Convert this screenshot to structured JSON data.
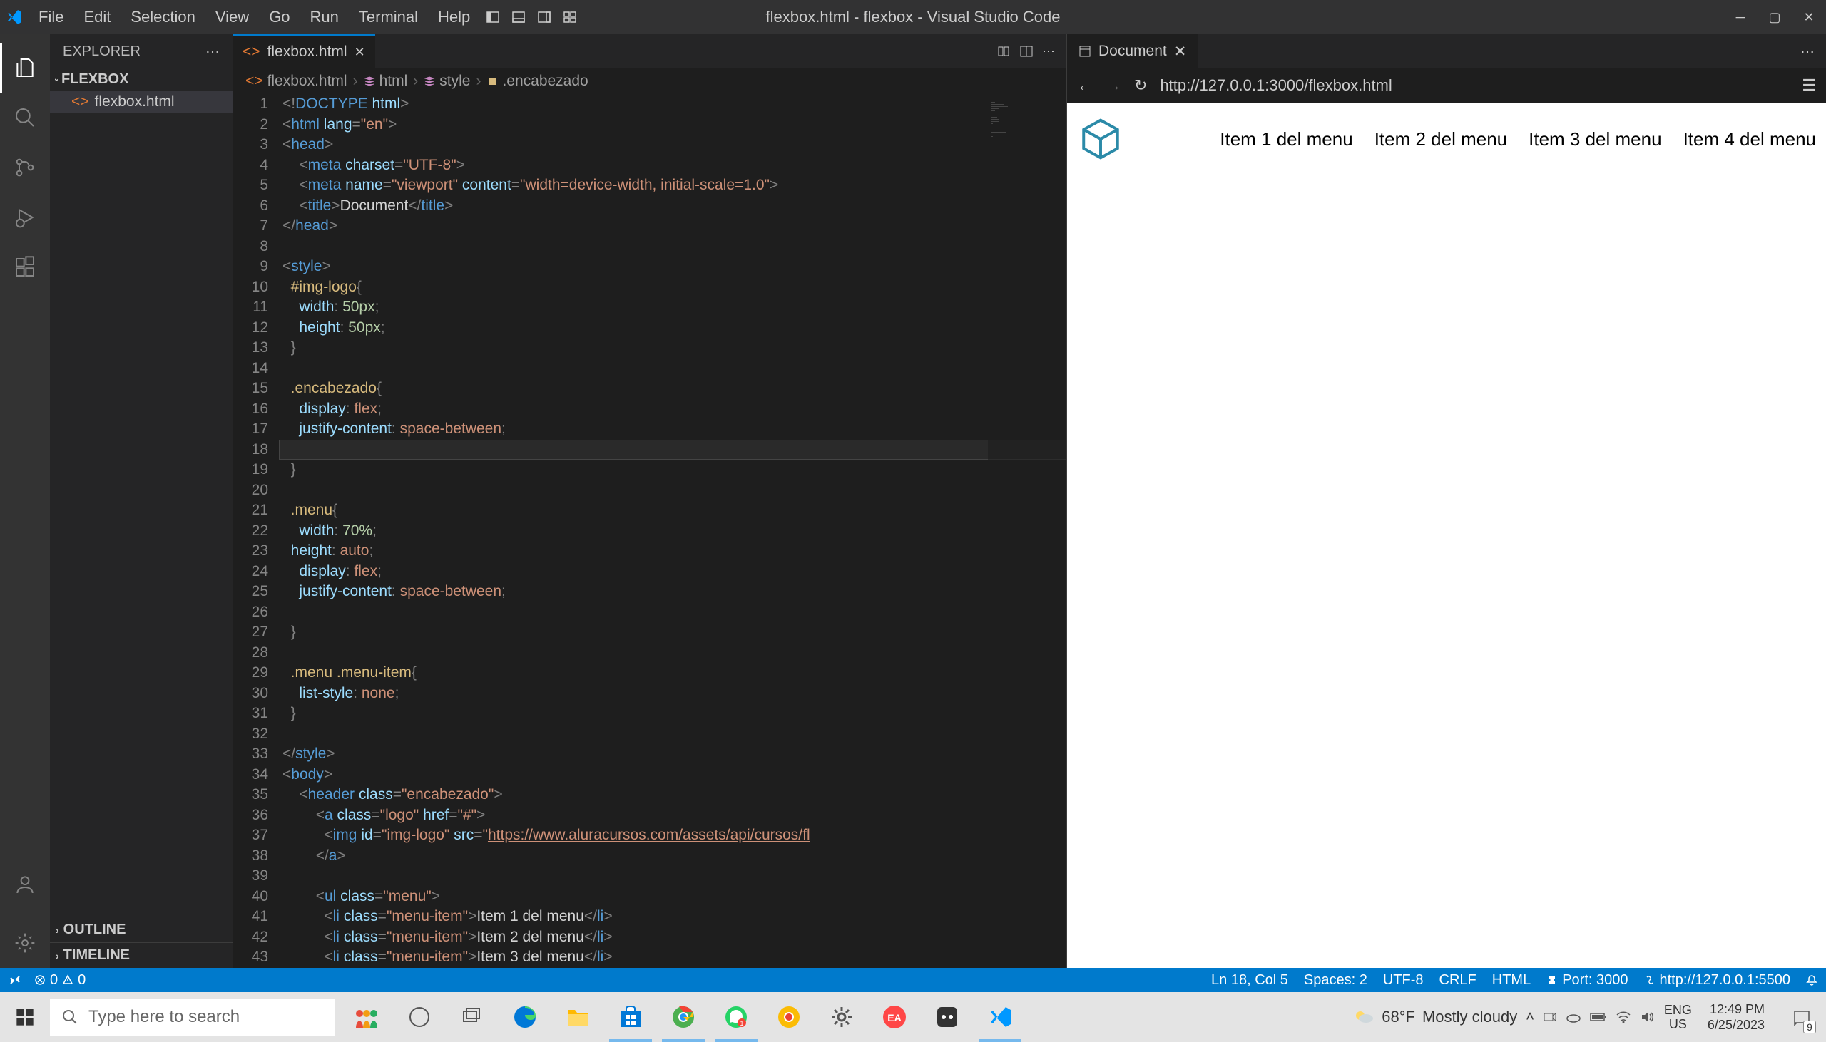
{
  "titlebar": {
    "menu": [
      "File",
      "Edit",
      "Selection",
      "View",
      "Go",
      "Run",
      "Terminal",
      "Help"
    ],
    "title": "flexbox.html - flexbox - Visual Studio Code"
  },
  "sidebar": {
    "header": "EXPLORER",
    "project": "FLEXBOX",
    "file": "flexbox.html",
    "outline": "OUTLINE",
    "timeline": "TIMELINE"
  },
  "tabs": {
    "active": "flexbox.html"
  },
  "breadcrumb": [
    "flexbox.html",
    "html",
    "style",
    ".encabezado"
  ],
  "code_lines": [
    1,
    2,
    3,
    4,
    5,
    6,
    7,
    8,
    9,
    10,
    11,
    12,
    13,
    14,
    15,
    16,
    17,
    18,
    19,
    20,
    21,
    22,
    23,
    24,
    25,
    26,
    27,
    28,
    29,
    30,
    31,
    32,
    33,
    34,
    35,
    36,
    37,
    38,
    39,
    40,
    41,
    42,
    43
  ],
  "preview": {
    "tab": "Document",
    "url": "http://127.0.0.1:3000/flexbox.html",
    "menu_items": [
      "Item 1 del menu",
      "Item 2 del menu",
      "Item 3 del menu",
      "Item 4 del menu"
    ]
  },
  "statusbar": {
    "errors": "0",
    "warnings": "0",
    "line_col": "Ln 18, Col 5",
    "spaces": "Spaces: 2",
    "encoding": "UTF-8",
    "eol": "CRLF",
    "lang": "HTML",
    "port": "Port: 3000",
    "liveserver": "http://127.0.0.1:5500"
  },
  "taskbar": {
    "search_placeholder": "Type here to search",
    "weather_temp": "68°F",
    "weather_desc": "Mostly cloudy",
    "lang1": "ENG",
    "lang2": "US",
    "time": "12:49 PM",
    "date": "6/25/2023",
    "notif_count": "9"
  }
}
